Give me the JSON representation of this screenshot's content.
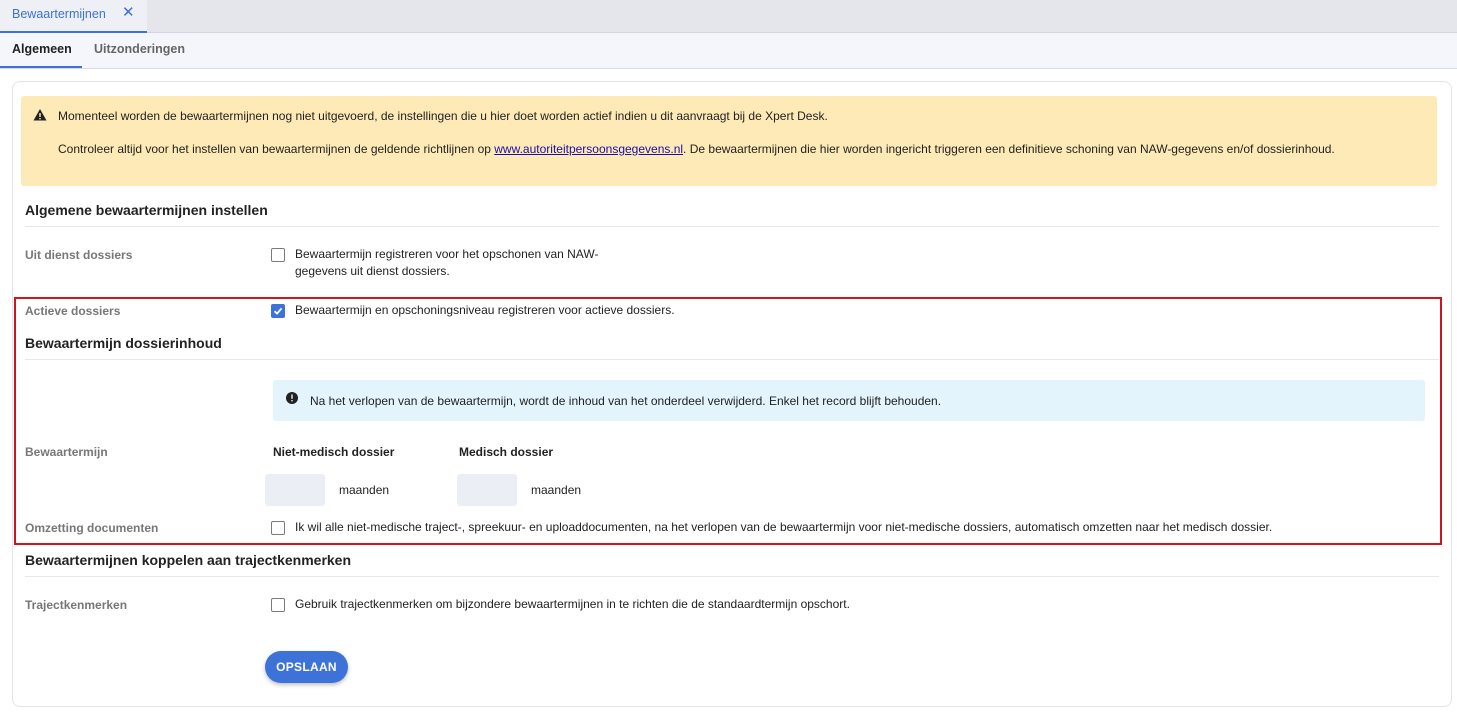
{
  "doc_tab": {
    "label": "Bewaartermijnen",
    "close": "✕"
  },
  "subtabs": [
    {
      "label": "Algemeen",
      "active": true
    },
    {
      "label": "Uitzonderingen",
      "active": false
    }
  ],
  "warning": {
    "line1": "Momenteel worden de bewaartermijnen nog niet uitgevoerd, de instellingen die u hier doet worden actief indien u dit aanvraagt bij de Xpert Desk.",
    "line2_before": "Controleer altijd voor het instellen van bewaartermijnen de geldende richtlijnen op ",
    "line2_link": "www.autoriteitpersoonsgegevens.nl",
    "line2_after": ". De bewaartermijnen die hier worden ingericht triggeren een definitieve schoning van NAW-gegevens en/of dossierinhoud."
  },
  "section_general": {
    "title": "Algemene bewaartermijnen instellen",
    "uit_dienst": {
      "label": "Uit dienst dossiers",
      "checkbox_text_1": "Bewaartermijn registreren voor het opschonen van NAW-",
      "checkbox_text_2": "gegevens uit dienst dossiers.",
      "checked": false
    },
    "actieve": {
      "label": "Actieve dossiers",
      "checkbox_text": "Bewaartermijn en opschoningsniveau registreren voor actieve dossiers.",
      "checked": true
    }
  },
  "section_content": {
    "title": "Bewaartermijn dossierinhoud",
    "info": "Na het verlopen van de bewaartermijn, wordt de inhoud van het onderdeel verwijderd. Enkel het record blijft behouden.",
    "bewaartermijn_label": "Bewaartermijn",
    "col_non_medical": "Niet-medisch dossier",
    "col_medical": "Medisch dossier",
    "non_medical_value": "",
    "medical_value": "",
    "unit": "maanden",
    "omzetting": {
      "label": "Omzetting documenten",
      "checkbox_text": "Ik wil alle niet-medische traject-, spreekuur- en uploaddocumenten, na het verlopen van de bewaartermijn voor niet-medische dossiers, automatisch omzetten naar het medisch dossier.",
      "checked": false
    }
  },
  "section_traject": {
    "title": "Bewaartermijnen koppelen aan trajectkenmerken",
    "label": "Trajectkenmerken",
    "checkbox_text": "Gebruik trajectkenmerken om bijzondere bewaartermijnen in te richten die de standaardtermijn opschort.",
    "checked": false
  },
  "save_label": "OPSLAAN",
  "colors": {
    "accent": "#3d72d8",
    "warning_bg": "#feeab6",
    "info_bg": "#e3f4fc",
    "highlight": "#d0141f"
  }
}
